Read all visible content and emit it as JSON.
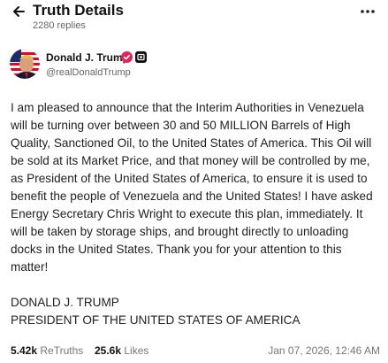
{
  "header": {
    "title": "Truth Details",
    "replies": "2280 replies"
  },
  "author": {
    "name": "Donald J. Trump",
    "handle": "@realDonaldTrump"
  },
  "post": {
    "text": "I am pleased to announce that the Interim Authorities in Venezuela will be turning over between 30 and 50 MILLION Barrels of High Quality, Sanctioned Oil, to the United States of America. This Oil will be sold at its Market Price, and that money will be controlled by me, as President of the United States of America, to ensure it is used to benefit the people of Venezuela and the United States! I have asked Energy Secretary Chris Wright to execute this plan, immediately. It will be taken by storage ships, and brought directly to unloading docks in the United States. Thank you for your attention to this matter!\n\nDONALD J. TRUMP\nPRESIDENT OF THE UNITED STATES OF AMERICA"
  },
  "stats": {
    "retruths_count": "5.42k",
    "retruths_label": "ReTruths",
    "likes_count": "25.6k",
    "likes_label": "Likes"
  },
  "timestamp": "Jan 07, 2026, 12:46 AM",
  "colors": {
    "verified_badge": "#e0245e",
    "accent": "#111111"
  },
  "icons": {
    "back": "arrow-left-icon",
    "more": "more-horizontal-icon",
    "verified": "verified-badge-icon",
    "label": "account-label-icon"
  }
}
